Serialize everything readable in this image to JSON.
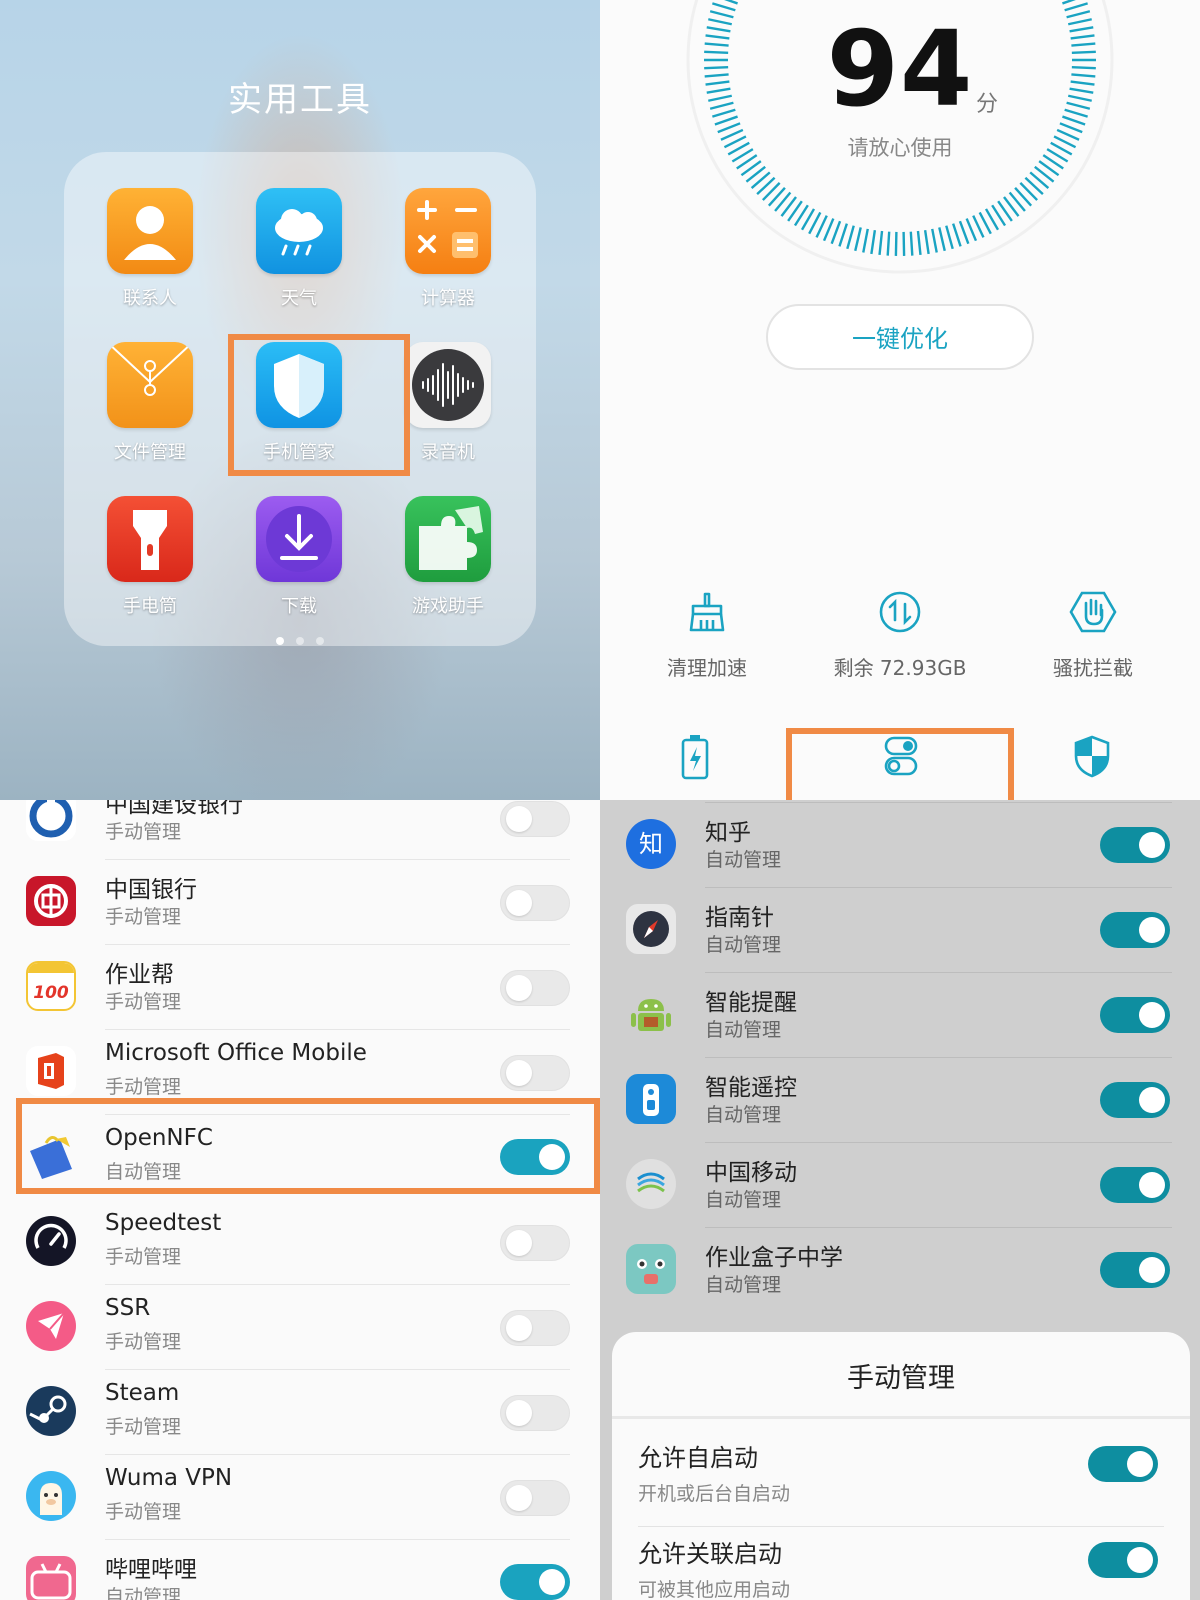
{
  "folder": {
    "title": "实用工具",
    "apps": [
      {
        "label": "联系人",
        "icon": "contacts-icon"
      },
      {
        "label": "天气",
        "icon": "weather-icon"
      },
      {
        "label": "计算器",
        "icon": "calculator-icon"
      },
      {
        "label": "文件管理",
        "icon": "file-manager-icon"
      },
      {
        "label": "手机管家",
        "icon": "phone-manager-icon"
      },
      {
        "label": "录音机",
        "icon": "recorder-icon"
      },
      {
        "label": "手电筒",
        "icon": "flashlight-icon"
      },
      {
        "label": "下载",
        "icon": "download-icon"
      },
      {
        "label": "游戏助手",
        "icon": "game-assistant-icon"
      }
    ],
    "page_count": 3,
    "current_page": 1
  },
  "manager": {
    "score": "94",
    "score_unit": "分",
    "status": "请放心使用",
    "optimize_button": "一键优化",
    "tools": [
      {
        "label": "清理加速",
        "icon": "broom-icon"
      },
      {
        "label": "剩余 72.93GB",
        "icon": "data-usage-icon"
      },
      {
        "label": "骚扰拦截",
        "icon": "block-hand-icon"
      }
    ],
    "bottom_icons": [
      "battery-icon",
      "toggle-manage-icon",
      "shield-icon"
    ],
    "accent": "#1aa3c2"
  },
  "app_list": {
    "rows": [
      {
        "name": "中国建设银行",
        "status": "手动管理",
        "on": false,
        "icon": "ccb-icon"
      },
      {
        "name": "中国银行",
        "status": "手动管理",
        "on": false,
        "icon": "boc-icon"
      },
      {
        "name": "作业帮",
        "status": "手动管理",
        "on": false,
        "icon": "zuoyebang-icon"
      },
      {
        "name": "Microsoft Office Mobile",
        "status": "手动管理",
        "on": false,
        "icon": "office-icon"
      },
      {
        "name": "OpenNFC",
        "status": "自动管理",
        "on": true,
        "icon": "opennfc-icon"
      },
      {
        "name": "Speedtest",
        "status": "手动管理",
        "on": false,
        "icon": "speedtest-icon"
      },
      {
        "name": "SSR",
        "status": "手动管理",
        "on": false,
        "icon": "ssr-icon"
      },
      {
        "name": "Steam",
        "status": "手动管理",
        "on": false,
        "icon": "steam-icon"
      },
      {
        "name": "Wuma VPN",
        "status": "手动管理",
        "on": false,
        "icon": "wuma-vpn-icon"
      },
      {
        "name": "哔哩哔哩",
        "status": "自动管理",
        "on": true,
        "icon": "bilibili-icon"
      }
    ]
  },
  "auto_list": {
    "rows": [
      {
        "name": "知乎",
        "status": "自动管理",
        "on": true,
        "icon": "zhihu-icon"
      },
      {
        "name": "指南针",
        "status": "自动管理",
        "on": true,
        "icon": "compass-icon"
      },
      {
        "name": "智能提醒",
        "status": "自动管理",
        "on": true,
        "icon": "android-icon"
      },
      {
        "name": "智能遥控",
        "status": "自动管理",
        "on": true,
        "icon": "remote-control-icon"
      },
      {
        "name": "中国移动",
        "status": "自动管理",
        "on": true,
        "icon": "china-mobile-icon"
      },
      {
        "name": "作业盒子中学",
        "status": "自动管理",
        "on": true,
        "icon": "zuoyehezi-icon"
      }
    ]
  },
  "sheet": {
    "title": "手动管理",
    "options": [
      {
        "title": "允许自启动",
        "subtitle": "开机或后台自启动",
        "on": true
      },
      {
        "title": "允许关联启动",
        "subtitle": "可被其他应用启动",
        "on": true
      }
    ]
  }
}
